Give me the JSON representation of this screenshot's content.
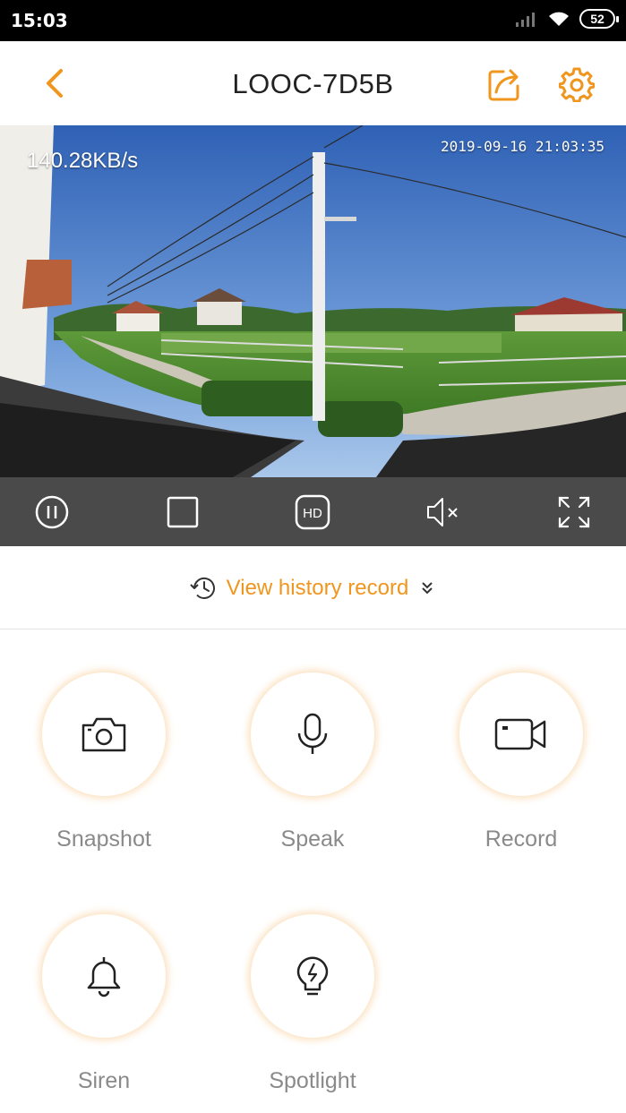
{
  "status_bar": {
    "time": "15:03",
    "battery": "52"
  },
  "header": {
    "title": "LOOC-7D5B"
  },
  "video": {
    "speed": "140.28KB/s",
    "timestamp": "2019-09-16 21:03:35"
  },
  "controls": {
    "items": [
      {
        "icon": "pause-icon"
      },
      {
        "icon": "stop-icon"
      },
      {
        "icon": "hd-icon",
        "label": "HD"
      },
      {
        "icon": "mute-icon"
      },
      {
        "icon": "fullscreen-icon"
      }
    ]
  },
  "history": {
    "label": "View history record"
  },
  "actions": [
    {
      "label": "Snapshot",
      "icon": "camera-icon"
    },
    {
      "label": "Speak",
      "icon": "microphone-icon"
    },
    {
      "label": "Record",
      "icon": "video-camera-icon"
    },
    {
      "label": "Siren",
      "icon": "bell-icon"
    },
    {
      "label": "Spotlight",
      "icon": "lightbulb-icon"
    }
  ],
  "colors": {
    "accent": "#f0961e",
    "controls_bg": "#4a4a4a",
    "label_gray": "#8a8a8a"
  }
}
